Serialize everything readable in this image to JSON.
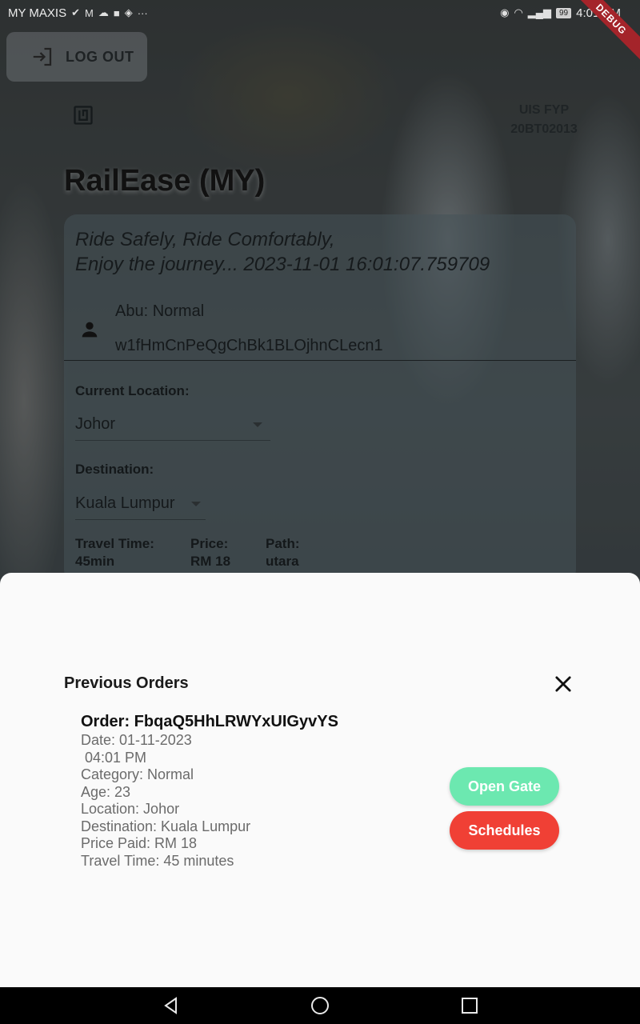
{
  "status_bar": {
    "carrier": "MY MAXIS",
    "battery": "99",
    "time": "4:01 PM",
    "debug_label": "DEBUG"
  },
  "header": {
    "logout_label": "LOG OUT",
    "fyp_line1": "UIS FYP",
    "fyp_line2": "20BT02013",
    "app_title": "RailEase (MY)"
  },
  "card": {
    "slogan": "Ride Safely,   Ride Comfortably,\nEnjoy the journey... 2023-11-01 16:01:07.759709",
    "user_name": "Abu: Normal",
    "user_id": "w1fHmCnPeQgChBk1BLOjhnCLecn1",
    "current_location_label": "Current Location:",
    "current_location_value": "Johor",
    "destination_label": "Destination:",
    "destination_value": "Kuala Lumpur",
    "travel_time_label": "Travel Time:",
    "travel_time_value": "45min",
    "price_label": "Price:",
    "price_value": "RM 18",
    "path_label": "Path:",
    "path_value": "utara"
  },
  "sheet": {
    "title": "Previous Orders",
    "order_title": "Order: FbqaQ5HhLRWYxUIGyvYS",
    "order_lines": [
      "Date: 01-11-2023",
      " 04:01 PM",
      "Category: Normal",
      "Age: 23",
      "Location: Johor",
      "Destination: Kuala Lumpur",
      "Price Paid: RM 18",
      "Travel Time: 45 minutes"
    ],
    "open_gate_label": "Open Gate",
    "schedules_label": "Schedules"
  },
  "colors": {
    "open_gate": "#6ce8b0",
    "schedules": "#f04035",
    "debug_ribbon": "#a4242a"
  }
}
